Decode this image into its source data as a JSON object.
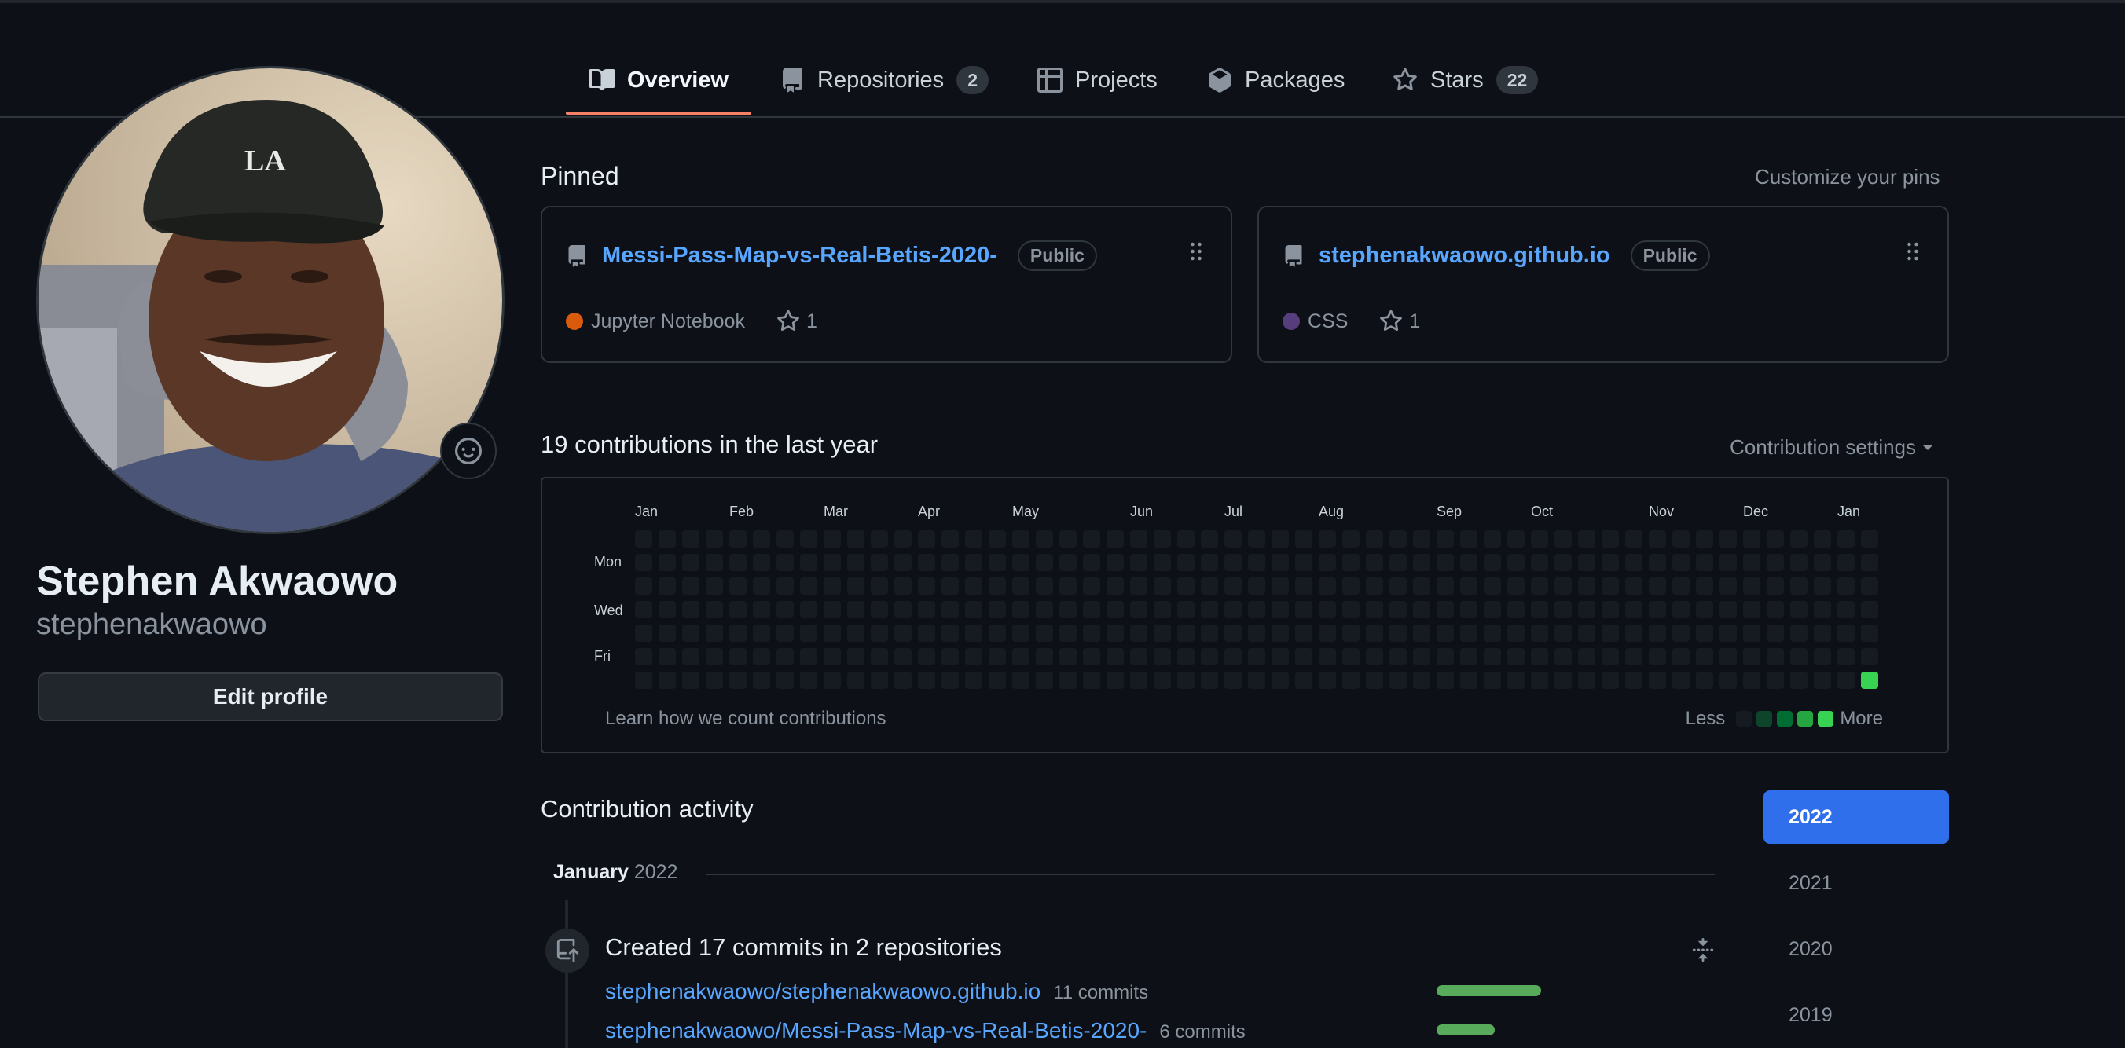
{
  "tabs": [
    {
      "label": "Overview",
      "icon": "book-icon",
      "active": true
    },
    {
      "label": "Repositories",
      "icon": "repo-icon",
      "count": "2"
    },
    {
      "label": "Projects",
      "icon": "table-icon"
    },
    {
      "label": "Packages",
      "icon": "package-icon"
    },
    {
      "label": "Stars",
      "icon": "star-icon",
      "count": "22"
    }
  ],
  "profile": {
    "full_name": "Stephen Akwaowo",
    "username": "stephenakwaowo",
    "edit_label": "Edit profile",
    "status_icon": "smiley-icon"
  },
  "pinned": {
    "heading": "Pinned",
    "customize_label": "Customize your pins",
    "cards": [
      {
        "name": "Messi-Pass-Map-vs-Real-Betis-2020-",
        "visibility": "Public",
        "language": "Jupyter Notebook",
        "language_color": "#DA5B0B",
        "stars": "1"
      },
      {
        "name": "stephenakwaowo.github.io",
        "visibility": "Public",
        "language": "CSS",
        "language_color": "#563d7c",
        "stars": "1"
      }
    ]
  },
  "contributions": {
    "heading": "19 contributions in the last year",
    "settings_label": "Contribution settings",
    "months": [
      "Jan",
      "Feb",
      "Mar",
      "Apr",
      "May",
      "Jun",
      "Jul",
      "Aug",
      "Sep",
      "Oct",
      "Nov",
      "Dec",
      "Jan"
    ],
    "weekday_labels": [
      "Mon",
      "Wed",
      "Fri"
    ],
    "weeks": 53,
    "active_cells": [
      {
        "week": 52,
        "day": 6,
        "level": 4
      }
    ],
    "learn_label": "Learn how we count contributions",
    "legend_less": "Less",
    "legend_more": "More",
    "level_colors": [
      "#161b22",
      "#0e4429",
      "#006d32",
      "#26a641",
      "#39d353"
    ]
  },
  "activity": {
    "heading": "Contribution activity",
    "years": [
      "2022",
      "2021",
      "2020",
      "2019"
    ],
    "selected_year": "2022",
    "month_label": "January",
    "month_year": "2022",
    "event_title": "Created 17 commits in 2 repositories",
    "repos": [
      {
        "name": "stephenakwaowo/stephenakwaowo.github.io",
        "commits": "11 commits",
        "fraction": 0.5625
      },
      {
        "name": "stephenakwaowo/Messi-Pass-Map-vs-Real-Betis-2020-",
        "commits": "6 commits",
        "fraction": 0.3125
      }
    ]
  }
}
